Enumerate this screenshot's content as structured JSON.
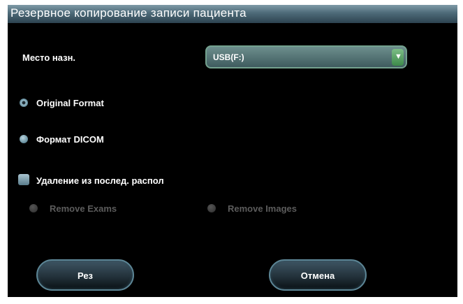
{
  "dialog": {
    "title": "Резервное копирование записи пациента",
    "destination": {
      "label": "Место назн.",
      "value": "USB(F:)",
      "arrow_icon": "▼"
    },
    "format_options": [
      {
        "label": "Original Format",
        "selected": true
      },
      {
        "label": "Формат DICOM",
        "selected": false
      }
    ],
    "delete_after": {
      "label": "Удаление из послед. распол",
      "checked": false
    },
    "remove_options": [
      {
        "label": "Remove Exams",
        "enabled": false
      },
      {
        "label": "Remove Images",
        "enabled": false
      }
    ],
    "buttons": {
      "ok_label": "Рез",
      "cancel_label": "Отмена"
    }
  },
  "colors": {
    "background": "#000000",
    "titlebar": "#4d6a78",
    "dropdown_border": "#74a28f",
    "arrow_button": "#3d8a4a",
    "disabled_text": "#5c5c5c"
  }
}
